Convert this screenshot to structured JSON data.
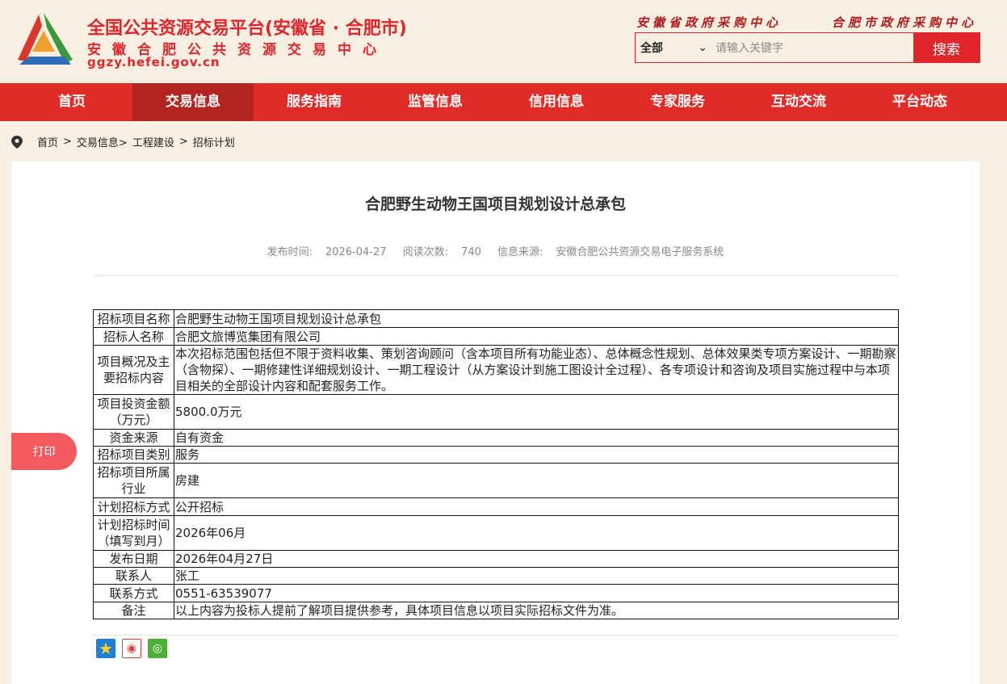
{
  "header": {
    "title": "全国公共资源交易平台(安徽省 · 合肥市)",
    "subtitle": "安徽合肥公共资源交易中心",
    "domain": "ggzy.hefei.gov.cn",
    "link1": "安徽省政府采购中心",
    "link2": "合肥市政府采购中心"
  },
  "search": {
    "scope": "全部",
    "placeholder": "请输入关键字",
    "button": "搜索"
  },
  "nav": [
    "首页",
    "交易信息",
    "服务指南",
    "监管信息",
    "信用信息",
    "专家服务",
    "互动交流",
    "平台动态"
  ],
  "breadcrumb": [
    "首页",
    ">",
    "交易信息>",
    "工程建设",
    ">",
    "招标计划"
  ],
  "article": {
    "title": "合肥野生动物王国项目规划设计总承包",
    "publish_label": "发布时间:",
    "publish_date": "2026-04-27",
    "views_label": "阅读次数:",
    "views": "740",
    "source_label": "信息来源:",
    "source": "安徽合肥公共资源交易电子服务系统"
  },
  "table": [
    [
      "招标项目名称",
      "合肥野生动物王国项目规划设计总承包"
    ],
    [
      "招标人名称",
      "合肥文旅博览集团有限公司"
    ],
    [
      "项目概况及主要招标内容",
      "本次招标范围包括但不限于资料收集、策划咨询顾问（含本项目所有功能业态）、总体概念性规划、总体效果类专项方案设计、一期勘察（含物探）、一期修建性详细规划设计、一期工程设计（从方案设计到施工图设计全过程）、各专项设计和咨询及项目实施过程中与本项目相关的全部设计内容和配套服务工作。"
    ],
    [
      "项目投资金额（万元）",
      "5800.0万元"
    ],
    [
      "资金来源",
      "自有资金"
    ],
    [
      "招标项目类别",
      "服务"
    ],
    [
      "招标项目所属行业",
      "房建"
    ],
    [
      "计划招标方式",
      "公开招标"
    ],
    [
      "计划招标时间（填写到月）",
      "2026年06月"
    ],
    [
      "发布日期",
      "2026年04月27日"
    ],
    [
      "联系人",
      "张工"
    ],
    [
      "联系方式",
      "0551-63539077"
    ],
    [
      "备注",
      "以上内容为投标人提前了解项目提供参考，具体项目信息以项目实际招标文件为准。"
    ]
  ],
  "print": "打印"
}
